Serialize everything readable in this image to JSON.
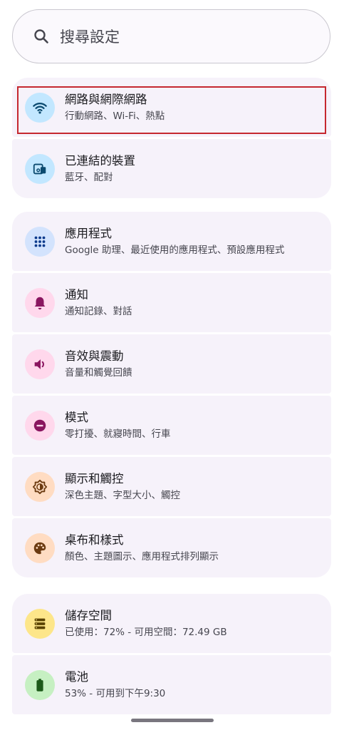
{
  "search": {
    "placeholder": "搜尋設定"
  },
  "groups": [
    {
      "items": [
        {
          "title": "網路與網際網路",
          "subtitle": "行動網路、Wi-Fi、熱點",
          "icon": "wifi-icon",
          "icon_bg": "#c2e7ff",
          "icon_color": "#0b4a6f"
        },
        {
          "title": "已連結的裝置",
          "subtitle": "藍牙、配對",
          "icon": "connected-devices-icon",
          "icon_bg": "#c2e7ff",
          "icon_color": "#0b4a6f"
        }
      ]
    },
    {
      "items": [
        {
          "title": "應用程式",
          "subtitle": "Google 助理、最近使用的應用程式、預設應用程式",
          "icon": "apps-grid-icon",
          "icon_bg": "#d3e3fd",
          "icon_color": "#0b3a8c"
        },
        {
          "title": "通知",
          "subtitle": "通知記錄、對話",
          "icon": "bell-icon",
          "icon_bg": "#ffd8ec",
          "icon_color": "#8a1660"
        },
        {
          "title": "音效與震動",
          "subtitle": "音量和觸覺回饋",
          "icon": "volume-icon",
          "icon_bg": "#ffd8ec",
          "icon_color": "#8a1660"
        },
        {
          "title": "模式",
          "subtitle": "零打擾、就寢時間、行車",
          "icon": "do-not-disturb-icon",
          "icon_bg": "#ffd8ec",
          "icon_color": "#8a1660"
        },
        {
          "title": "顯示和觸控",
          "subtitle": "深色主題、字型大小、觸控",
          "icon": "brightness-icon",
          "icon_bg": "#ffdcc2",
          "icon_color": "#6b3a10"
        },
        {
          "title": "桌布和樣式",
          "subtitle": "顏色、主題圖示、應用程式排列顯示",
          "icon": "palette-icon",
          "icon_bg": "#ffdcc2",
          "icon_color": "#6b3a10"
        }
      ]
    },
    {
      "items": [
        {
          "title": "儲存空間",
          "subtitle": "已使用：72% - 可用空間：72.49 GB",
          "icon": "storage-icon",
          "icon_bg": "#fde68a",
          "icon_color": "#5a4300"
        },
        {
          "title": "電池",
          "subtitle": "53% - 可用到下午9:30",
          "icon": "battery-icon",
          "icon_bg": "#c6f0c2",
          "icon_color": "#1d5a1a"
        }
      ]
    }
  ]
}
